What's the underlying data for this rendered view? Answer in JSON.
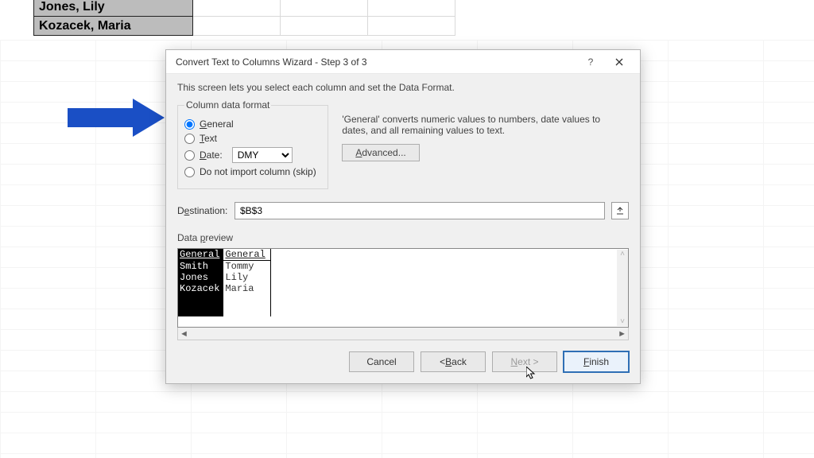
{
  "sheet": {
    "rows": [
      {
        "a": "Jones, Lily"
      },
      {
        "a": "Kozacek, Maria"
      }
    ]
  },
  "dialog": {
    "title": "Convert Text to Columns Wizard - Step 3 of 3",
    "desc": "This screen lets you select each column and set the Data Format.",
    "legend": "Column data format",
    "radios": {
      "general": "General",
      "text": "Text",
      "date": "Date:",
      "skip": "Do not import column (skip)"
    },
    "date_format": "DMY",
    "explain": "'General' converts numeric values to numbers, date values to dates, and all remaining values to text.",
    "advanced": "Advanced...",
    "dest_label": "Destination:",
    "dest_value": "$B$3",
    "preview_label": "Data preview",
    "preview": {
      "headers": [
        "General",
        "General"
      ],
      "rows": [
        [
          "Smith",
          "Tommy"
        ],
        [
          "Jones",
          "Lily"
        ],
        [
          "Kozacek",
          "Maria"
        ]
      ]
    },
    "buttons": {
      "cancel": "Cancel",
      "back": "< Back",
      "next": "Next >",
      "finish": "Finish"
    }
  }
}
